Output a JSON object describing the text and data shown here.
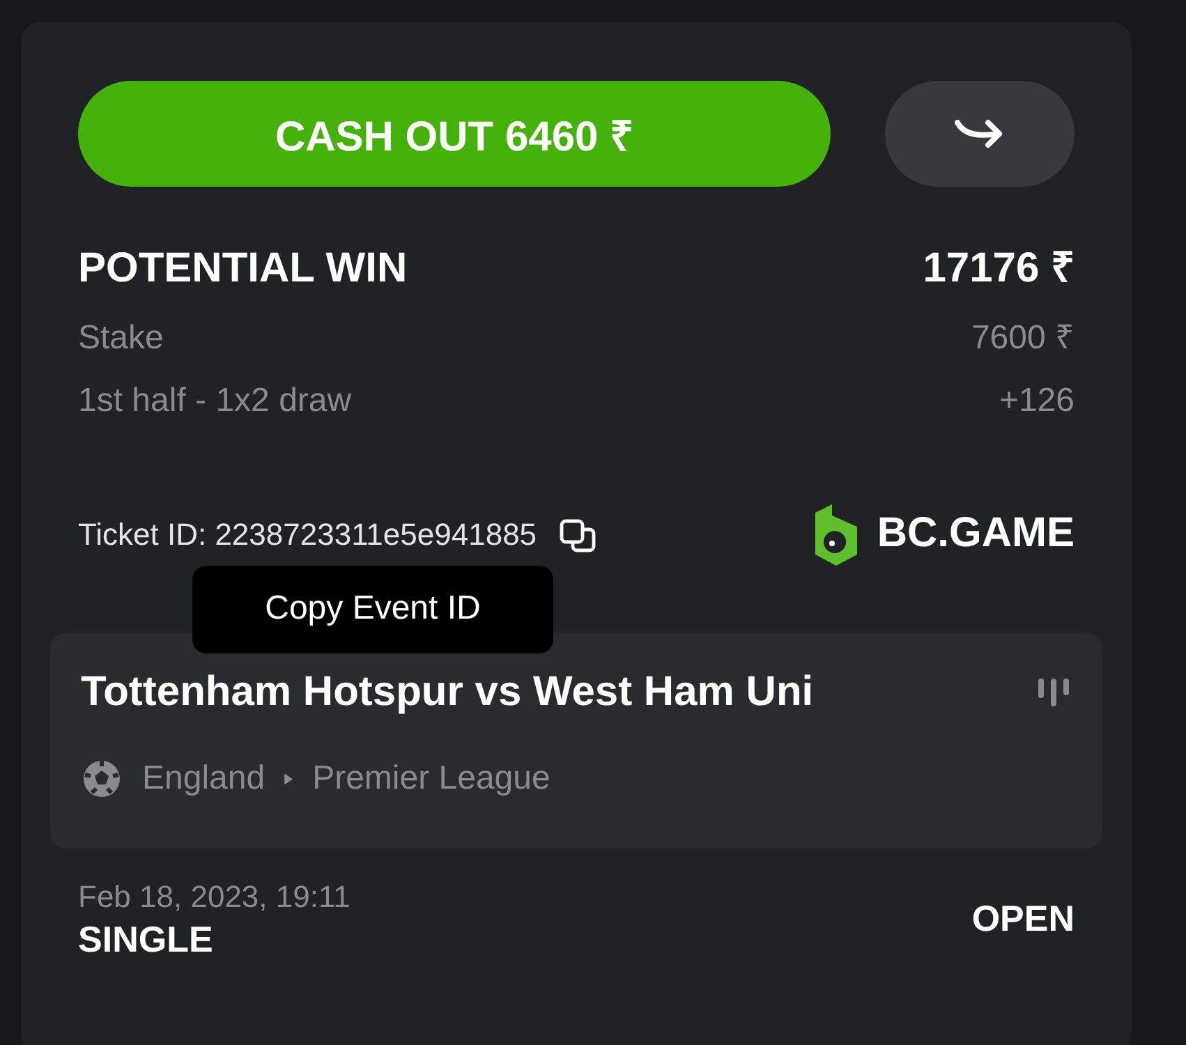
{
  "actions": {
    "cash_out": "CASH OUT 6460 ₹"
  },
  "summary": [
    {
      "kind": "total",
      "label": "POTENTIAL WIN",
      "value": "17176 ₹"
    },
    {
      "kind": "detail",
      "label": "Stake",
      "value": "7600 ₹"
    },
    {
      "kind": "detail",
      "label": "1st half - 1x2 draw",
      "value": "+126"
    }
  ],
  "ticket": {
    "id": "Ticket ID: 2238723311e5e941885",
    "brand": "BC.GAME"
  },
  "tooltip": "Copy Event ID",
  "event": {
    "title": "Tottenham Hotspur vs West Ham Uni",
    "country": "England",
    "league": "Premier League"
  },
  "bet": {
    "date": "Feb 18, 2023, 19:11",
    "type": "SINGLE",
    "status": "OPEN"
  }
}
